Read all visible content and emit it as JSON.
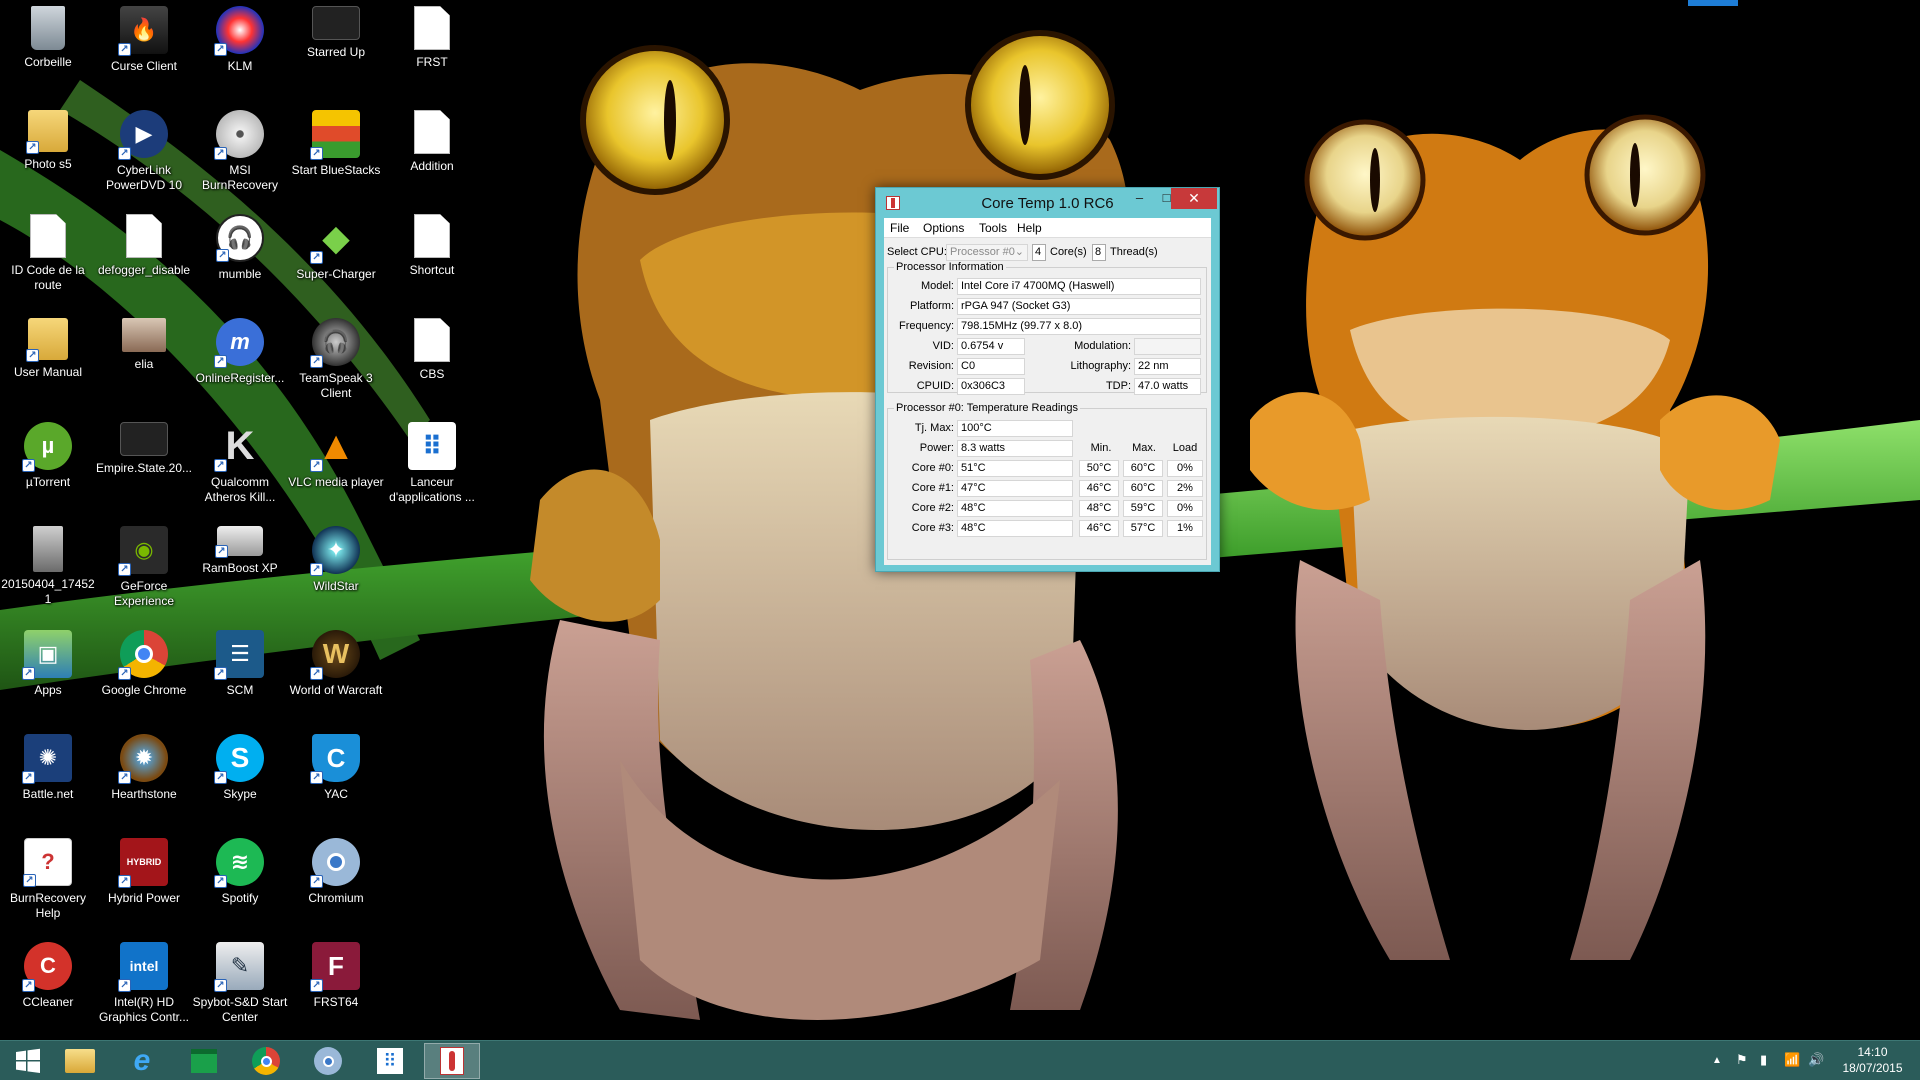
{
  "desktop": {
    "icons": [
      {
        "label": "Corbeille",
        "icon": "recycle-bin-icon"
      },
      {
        "label": "Curse Client",
        "icon": "curse-client-icon"
      },
      {
        "label": "KLM",
        "icon": "klm-icon"
      },
      {
        "label": "Starred Up",
        "icon": "video-file-icon"
      },
      {
        "label": "FRST",
        "icon": "blank-file-icon"
      },
      {
        "label": "Photo s5",
        "icon": "folder-icon"
      },
      {
        "label": "CyberLink PowerDVD 10",
        "icon": "powerdvd-icon"
      },
      {
        "label": "MSI BurnRecovery",
        "icon": "disc-icon"
      },
      {
        "label": "Start BlueStacks",
        "icon": "bluestacks-icon"
      },
      {
        "label": "Addition",
        "icon": "blank-file-icon"
      },
      {
        "label": "ID Code de la route",
        "icon": "blank-file-icon"
      },
      {
        "label": "defogger_disable",
        "icon": "blank-file-icon"
      },
      {
        "label": "mumble",
        "icon": "mumble-icon"
      },
      {
        "label": "Super-Charger",
        "icon": "super-charger-icon"
      },
      {
        "label": "Shortcut",
        "icon": "blank-file-icon"
      },
      {
        "label": "User Manual",
        "icon": "folder-icon"
      },
      {
        "label": "elia",
        "icon": "photo-icon"
      },
      {
        "label": "OnlineRegister...",
        "icon": "msi-online-icon"
      },
      {
        "label": "TeamSpeak 3 Client",
        "icon": "teamspeak-icon"
      },
      {
        "label": "CBS",
        "icon": "blank-file-icon"
      },
      {
        "label": "µTorrent",
        "icon": "utorrent-icon"
      },
      {
        "label": "Empire.State.20...",
        "icon": "video-file-icon"
      },
      {
        "label": "Qualcomm Atheros Kill...",
        "icon": "killer-icon"
      },
      {
        "label": "VLC media player",
        "icon": "vlc-icon"
      },
      {
        "label": "Lanceur d'applications ...",
        "icon": "app-launcher-icon"
      },
      {
        "label": "20150404_174521",
        "icon": "photo-icon"
      },
      {
        "label": "GeForce Experience",
        "icon": "geforce-icon"
      },
      {
        "label": "RamBoost XP",
        "icon": "ramboost-icon"
      },
      {
        "label": "WildStar",
        "icon": "wildstar-icon"
      },
      {
        "label": "Apps",
        "icon": "apps-icon"
      },
      {
        "label": "Google Chrome",
        "icon": "chrome-icon"
      },
      {
        "label": "SCM",
        "icon": "scm-icon"
      },
      {
        "label": "World of Warcraft",
        "icon": "wow-icon"
      },
      {
        "label": "Battle.net",
        "icon": "battlenet-icon"
      },
      {
        "label": "Hearthstone",
        "icon": "hearthstone-icon"
      },
      {
        "label": "Skype",
        "icon": "skype-icon"
      },
      {
        "label": "YAC",
        "icon": "yac-icon"
      },
      {
        "label": "BurnRecovery Help",
        "icon": "help-file-icon"
      },
      {
        "label": "Hybrid Power",
        "icon": "hybrid-power-icon"
      },
      {
        "label": "Spotify",
        "icon": "spotify-icon"
      },
      {
        "label": "Chromium",
        "icon": "chromium-icon"
      },
      {
        "label": "CCleaner",
        "icon": "ccleaner-icon"
      },
      {
        "label": "Intel(R) HD Graphics Contr...",
        "icon": "intel-graphics-icon"
      },
      {
        "label": "Spybot-S&D Start Center",
        "icon": "spybot-icon"
      },
      {
        "label": "FRST64",
        "icon": "frst64-icon"
      }
    ]
  },
  "coretemp": {
    "title": "Core Temp 1.0 RC6",
    "minimize": "–",
    "maximize": "□",
    "close": "✕",
    "menu": [
      "File",
      "Options",
      "Tools",
      "Help"
    ],
    "select_cpu_label": "Select CPU:",
    "processor_select": "Processor #0",
    "cores_value": "4",
    "cores_label": "Core(s)",
    "threads_value": "8",
    "threads_label": "Thread(s)",
    "proc_info_title": "Processor Information",
    "model_label": "Model:",
    "model": "Intel Core i7 4700MQ (Haswell)",
    "platform_label": "Platform:",
    "platform": "rPGA 947 (Socket G3)",
    "frequency_label": "Frequency:",
    "frequency": "798.15MHz (99.77 x 8.0)",
    "vid_label": "VID:",
    "vid": "0.6754 v",
    "modulation_label": "Modulation:",
    "modulation": "",
    "revision_label": "Revision:",
    "revision": "C0",
    "lithography_label": "Lithography:",
    "lithography": "22 nm",
    "cpuid_label": "CPUID:",
    "cpuid": "0x306C3",
    "tdp_label": "TDP:",
    "tdp": "47.0 watts",
    "temps_title": "Processor #0: Temperature Readings",
    "tjmax_label": "Tj. Max:",
    "tjmax": "100°C",
    "power_label": "Power:",
    "power": "8.3 watts",
    "col_min": "Min.",
    "col_max": "Max.",
    "col_load": "Load",
    "cores": [
      {
        "label": "Core #0:",
        "temp": "51°C",
        "min": "50°C",
        "max": "60°C",
        "load": "0%"
      },
      {
        "label": "Core #1:",
        "temp": "47°C",
        "min": "46°C",
        "max": "60°C",
        "load": "2%"
      },
      {
        "label": "Core #2:",
        "temp": "48°C",
        "min": "48°C",
        "max": "59°C",
        "load": "0%"
      },
      {
        "label": "Core #3:",
        "temp": "48°C",
        "min": "46°C",
        "max": "57°C",
        "load": "1%"
      }
    ]
  },
  "taskbar": {
    "pinned": [
      "start-button",
      "file-explorer",
      "internet-explorer",
      "store",
      "chrome",
      "chromium",
      "apps",
      "core-temp"
    ],
    "clock_time": "14:10",
    "clock_date": "18/07/2015"
  },
  "colors": {
    "taskbar": "#2b5c5a",
    "window_frame": "#6cc9d3",
    "close_button": "#c7393a"
  }
}
